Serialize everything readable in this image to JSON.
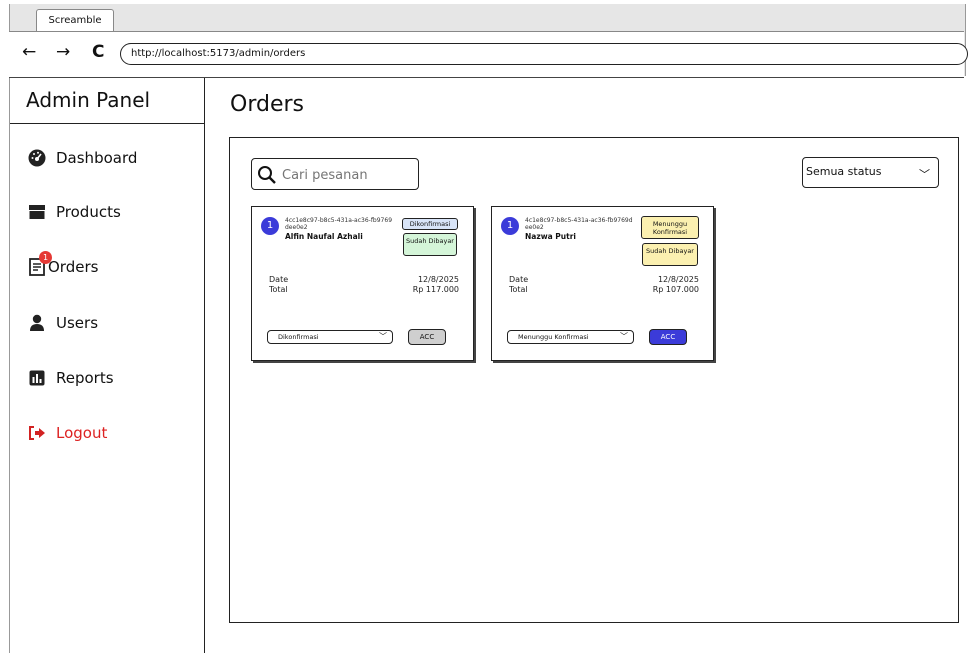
{
  "browser": {
    "tab_title": "Screamble",
    "url": "http://localhost:5173/admin/orders",
    "back": "←",
    "forward": "→",
    "reload": "C"
  },
  "sidebar": {
    "title": "Admin Panel",
    "items": [
      {
        "label": "Dashboard",
        "icon": "dashboard-icon"
      },
      {
        "label": "Products",
        "icon": "box-icon"
      },
      {
        "label": "Orders",
        "icon": "orders-icon",
        "badge": "1"
      },
      {
        "label": "Users",
        "icon": "user-icon"
      },
      {
        "label": "Reports",
        "icon": "chart-icon"
      },
      {
        "label": "Logout",
        "icon": "logout-icon",
        "color": "#d22222"
      }
    ]
  },
  "main": {
    "title": "Orders",
    "search": {
      "placeholder": "Cari pesanan"
    },
    "status_filter": {
      "selected": "Semua status"
    },
    "labels": {
      "date": "Date",
      "total": "Total",
      "acc": "ACC"
    },
    "orders": [
      {
        "number": "1",
        "id": "4cc1e8c97-b8c5-431a-ac36-fb9769dee0e2",
        "customer": "Alfin Naufal Azhali",
        "order_status": "Dikonfirmasi",
        "payment_status": "Sudah Dibayar",
        "date": "12/8/2025",
        "total": "Rp 117.000",
        "select_value": "Dikonfirmasi"
      },
      {
        "number": "1",
        "id": "4c1e8c97-b8c5-431a-ac36-fb9769dee0e2",
        "customer": "Nazwa Putri",
        "order_status": "Menunggu Konfirmasi",
        "payment_status": "Sudah Dibayar",
        "date": "12/8/2025",
        "total": "Rp 107.000",
        "select_value": "Menunggu Konfirmasi"
      }
    ]
  },
  "colors": {
    "accent": "#3b3bd9",
    "confirmed_pill": "#d8e4f8",
    "paid_pill": "#d4f5d8",
    "waiting_pill": "#fbf0b0",
    "logout": "#d22222",
    "acc_disabled": "#cfcfcf"
  }
}
